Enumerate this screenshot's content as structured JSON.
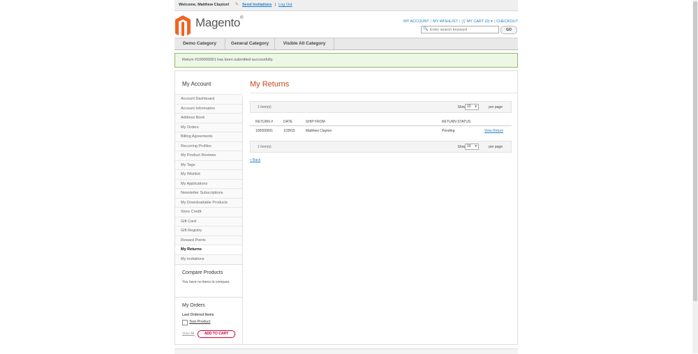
{
  "header": {
    "welcome": "Welcome, Matthew Clayton!",
    "send_invitations": "Send Invitations",
    "separator": "|",
    "logout": "Log Out",
    "logo_text": "Magento",
    "logo_mark": "®",
    "links": {
      "my_account": "MY ACCOUNT",
      "my_wishlist": "MY WISHLIST",
      "my_cart": "MY CART (0)",
      "checkout": "CHECKOUT"
    },
    "search_placeholder": "Enter search keyword",
    "go": "GO"
  },
  "nav": [
    "Demo Category",
    "General Category",
    "Visible All Category"
  ],
  "message": "Return #100000001 has been submitted successfully.",
  "sidebar": {
    "title": "My Account",
    "items": [
      "Account Dashboard",
      "Account Information",
      "Address Book",
      "My Orders",
      "Billing Agreements",
      "Recurring Profiles",
      "My Product Reviews",
      "My Tags",
      "My Wishlist",
      "My Applications",
      "Newsletter Subscriptions",
      "My Downloadable Products",
      "Store Credit",
      "Gift Card",
      "Gift Registry",
      "Reward Points",
      "My Returns",
      "My Invitations"
    ],
    "active_index": 16,
    "compare": {
      "title": "Compare Products",
      "text": "You have no items to compare."
    },
    "orders": {
      "title": "My Orders",
      "subtitle": "Last Ordered Items",
      "product": "Test Product",
      "view_all": "View All",
      "add_to_cart": "ADD TO CART"
    }
  },
  "main": {
    "title": "My Returns",
    "pager": {
      "count": "1 Item(s)",
      "show": "Show",
      "limit": "10",
      "per_page": "per page"
    },
    "columns": [
      "RETURN #",
      "DATE",
      "SHIP FROM",
      "RETURN STATUS"
    ],
    "rows": [
      {
        "return_no": "100000001",
        "date": "1/28/15",
        "ship_from": "Matthew Clayton",
        "status": "Pending",
        "action": "View Return"
      }
    ],
    "back": "« Back"
  }
}
